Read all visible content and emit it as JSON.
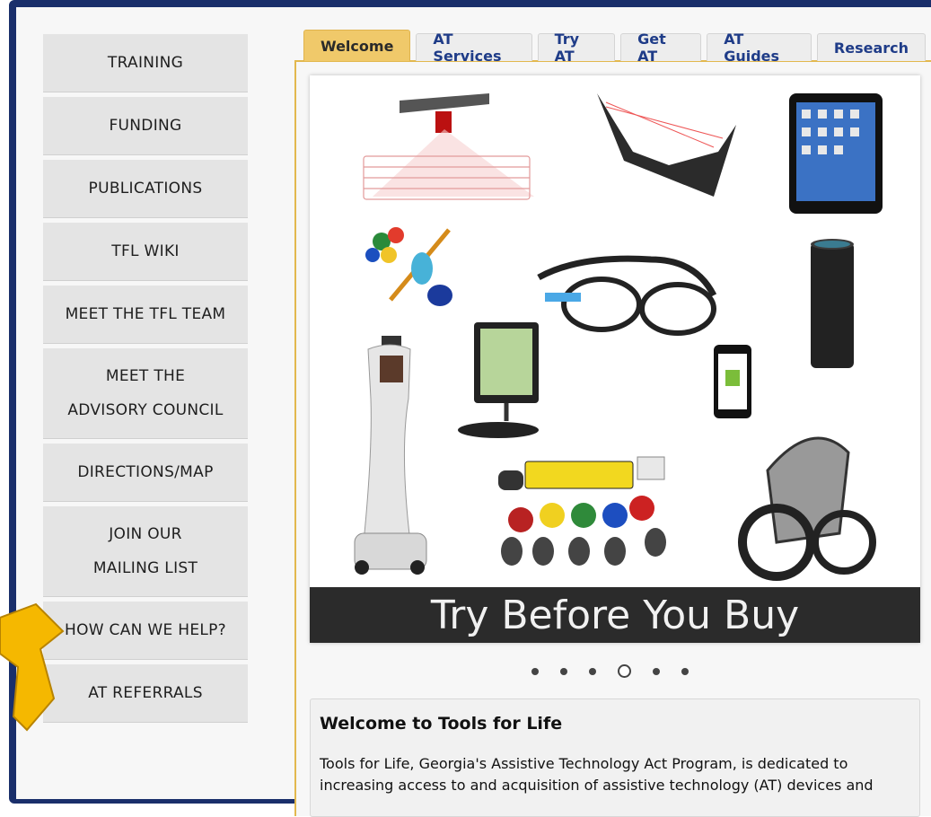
{
  "sidebar": {
    "items": [
      {
        "label": "TRAINING"
      },
      {
        "label": "FUNDING"
      },
      {
        "label": "PUBLICATIONS"
      },
      {
        "label": "TFL WIKI"
      },
      {
        "label": "MEET THE TFL TEAM"
      },
      {
        "line1": "MEET THE",
        "line2": "ADVISORY COUNCIL"
      },
      {
        "label": "DIRECTIONS/MAP"
      },
      {
        "line1": "JOIN OUR",
        "line2": "MAILING LIST"
      },
      {
        "label": "HOW CAN WE HELP?"
      },
      {
        "label": "AT REFERRALS"
      }
    ]
  },
  "tabs": [
    "Welcome",
    "AT Services",
    "Try AT",
    "Get AT",
    "AT Guides",
    "Research"
  ],
  "slide": {
    "caption": "Try Before You Buy",
    "active_dot": 4,
    "dot_count": 6
  },
  "welcome": {
    "title": "Welcome to Tools for Life",
    "body": "Tools for Life, Georgia's Assistive Technology Act Program, is dedicated to increasing access to and acquisition of assistive technology (AT) devices and"
  },
  "colors": {
    "frame": "#1a2f6b",
    "tab_active": "#f0c96a",
    "arrow": "#f5b800",
    "link": "#1f3c88"
  }
}
